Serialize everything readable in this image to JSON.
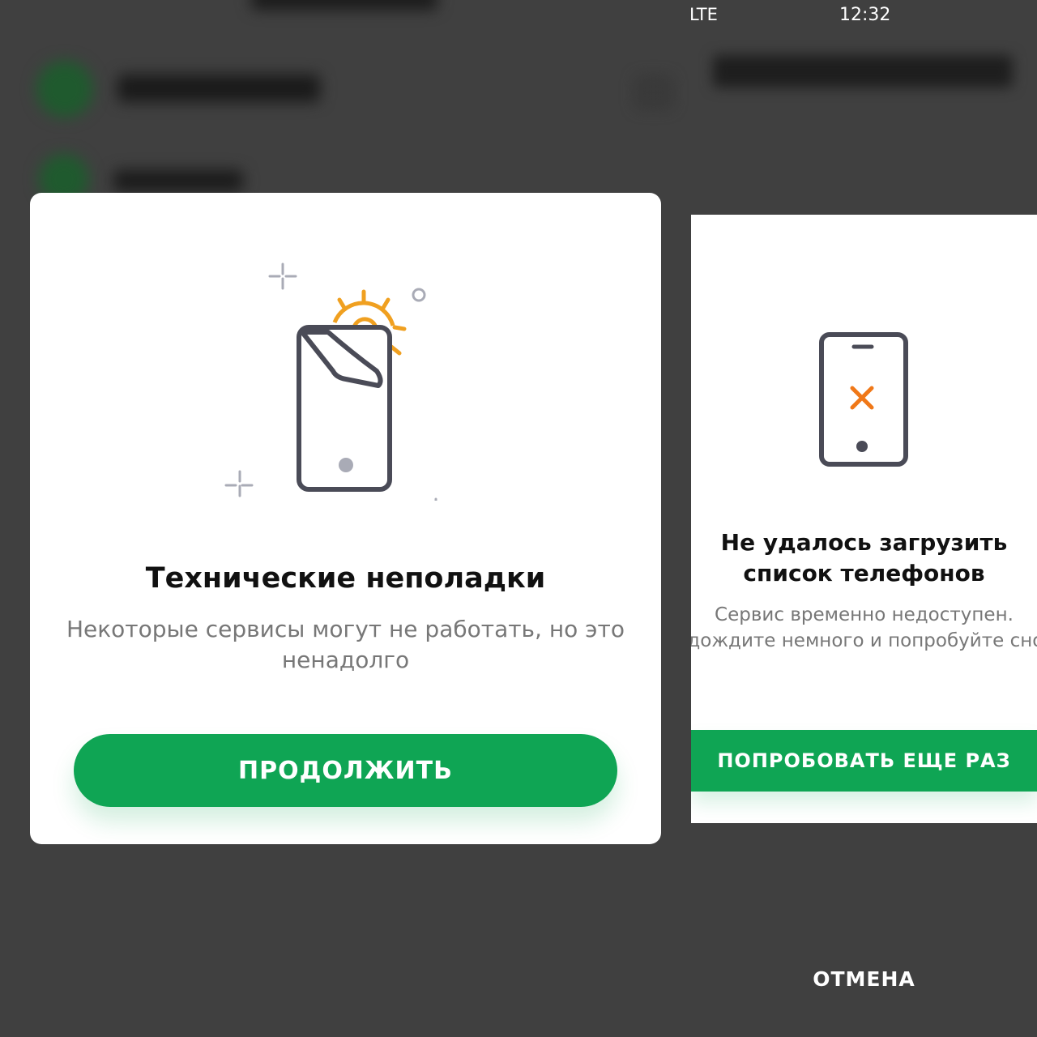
{
  "colors": {
    "accent_green": "#0fa554",
    "gear_orange": "#f0a020",
    "error_x_orange": "#f07818",
    "phone_outline": "#4a4b57",
    "backdrop": "#404040"
  },
  "left_dialog": {
    "title": "Технические неполадки",
    "description": "Некоторые сервисы могут не работать, но это ненадолго",
    "continue_button": "ПРОДОЛЖИТЬ",
    "icon": "phone-repair-gear-icon"
  },
  "right_screen": {
    "status_bar": {
      "network": "LTE",
      "time": "12:32"
    },
    "dialog": {
      "title": "Не удалось загрузить список телефонов",
      "description": "Сервис временно недоступен. Подождите немного и попробуйте снова",
      "retry_button": "ПОПРОБОВАТЬ ЕЩЕ РАЗ",
      "icon": "phone-error-icon"
    },
    "cancel_button": "ОТМЕНА"
  }
}
